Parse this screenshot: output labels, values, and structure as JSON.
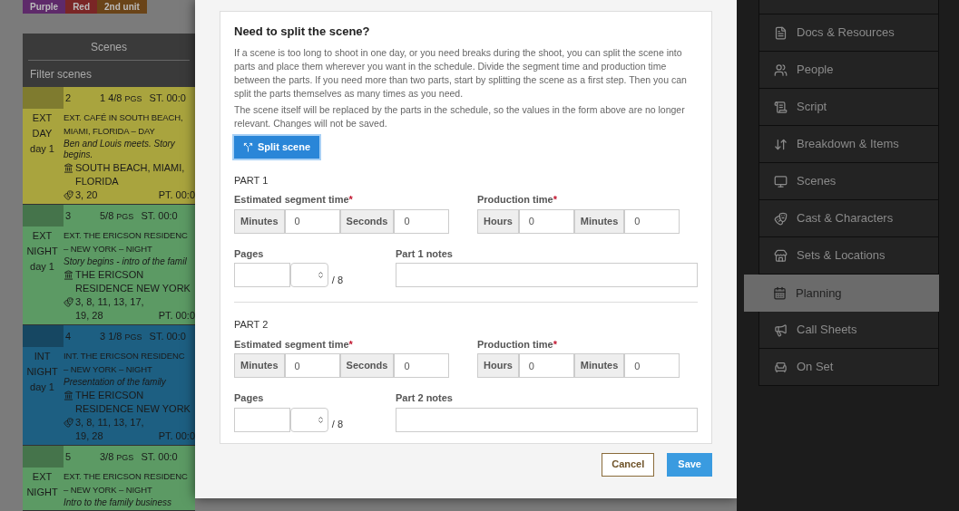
{
  "tags": [
    {
      "label": "Purple",
      "color": "#5e2a6a"
    },
    {
      "label": "Red",
      "color": "#7a2626"
    },
    {
      "label": "2nd unit",
      "color": "#6a4418"
    }
  ],
  "scenes_panel": {
    "title": "Scenes",
    "filter_placeholder": "Filter scenes",
    "scenes": [
      {
        "number": "2",
        "pages": "1 4/8",
        "pages_unit": "PGS",
        "start": "ST. 00:0",
        "int_ext": "EXT",
        "time_of_day": "DAY",
        "day": "day 1",
        "heading_lines": [
          "EXT. CAFÉ IN SOUTH BEACH,",
          "MIAMI, FLORIDA – DAY"
        ],
        "description": "Ben and Louis meets. Story begins.",
        "location": "SOUTH BEACH, MIAMI, FLORIDA",
        "cast": "3, 20",
        "pt": "PT. 00:0",
        "color": "#a9a43e"
      },
      {
        "number": "3",
        "pages": "5/8",
        "pages_unit": "PGS",
        "start": "ST. 00:0",
        "int_ext": "EXT",
        "time_of_day": "NIGHT",
        "day": "day 1",
        "heading_lines": [
          "EXT. THE ERICSON RESIDENC",
          "– NEW YORK – NIGHT"
        ],
        "description": "Story begins - intro of the famil",
        "location": "THE ERICSON RESIDENCE NEW YORK",
        "cast": "3, 8, 11, 13, 17, 19, 28",
        "pt": "PT. 00:0",
        "color": "#5c9a64"
      },
      {
        "number": "4",
        "pages": "3 1/8",
        "pages_unit": "PGS",
        "start": "ST. 00:0",
        "int_ext": "INT",
        "time_of_day": "NIGHT",
        "day": "day 1",
        "heading_lines": [
          "INT. THE ERICSON RESIDENC",
          "– NEW YORK – NIGHT"
        ],
        "description": "Presentation of the family",
        "location": "THE ERICSON RESIDENCE NEW YORK",
        "cast": "3, 8, 11, 13, 17, 19, 28",
        "pt": "PT. 00:0",
        "color": "#1d5f82"
      },
      {
        "number": "5",
        "pages": "3/8",
        "pages_unit": "PGS",
        "start": "ST. 00:0",
        "int_ext": "EXT",
        "time_of_day": "NIGHT",
        "heading_lines": [
          "EXT. THE ERICSON RESIDENC",
          "– NEW YORK – NIGHT"
        ],
        "description": "Intro to the family business",
        "color": "#5c9a64"
      }
    ]
  },
  "modal": {
    "title": "Need to split the scene?",
    "paragraphs": [
      "If a scene is too long to shoot in one day, or you need breaks during the shoot, you can split the scene into parts and place them wherever you want in the schedule. Divide the segment time and production time between the parts. If you need more than two parts, start by splitting the scene as a first step. Then you can split the parts themselves as many times as you need.",
      "The scene itself will be replaced by the parts in the schedule, so the values in the form above are no longer relevant. Changes will not be saved."
    ],
    "split_button": "Split scene",
    "parts": [
      {
        "title": "PART 1",
        "segment_label": "Estimated segment time",
        "segment_required": "*",
        "segment_fields": [
          {
            "addon": "Minutes",
            "value": "0"
          },
          {
            "addon": "Seconds",
            "value": "0"
          }
        ],
        "production_label": "Production time",
        "production_required": "*",
        "production_fields": [
          {
            "addon": "Hours",
            "value": "0"
          },
          {
            "addon": "Minutes",
            "value": "0"
          }
        ],
        "pages_label": "Pages",
        "pages_denominator": "/ 8",
        "notes_label": "Part 1 notes"
      },
      {
        "title": "PART 2",
        "segment_label": "Estimated segment time",
        "segment_required": "*",
        "segment_fields": [
          {
            "addon": "Minutes",
            "value": "0"
          },
          {
            "addon": "Seconds",
            "value": "0"
          }
        ],
        "production_label": "Production time",
        "production_required": "*",
        "production_fields": [
          {
            "addon": "Hours",
            "value": "0"
          },
          {
            "addon": "Minutes",
            "value": "0"
          }
        ],
        "pages_label": "Pages",
        "pages_denominator": "/ 8",
        "notes_label": "Part 2 notes"
      }
    ],
    "cancel": "Cancel",
    "save": "Save"
  },
  "nav": {
    "items": [
      {
        "label": "Docs & Resources",
        "selected": false
      },
      {
        "label": "People",
        "selected": false
      },
      {
        "label": "Script",
        "selected": false
      },
      {
        "label": "Breakdown & Items",
        "selected": false
      },
      {
        "label": "Scenes",
        "selected": false
      },
      {
        "label": "Cast & Characters",
        "selected": false
      },
      {
        "label": "Sets & Locations",
        "selected": false
      },
      {
        "label": "Planning",
        "selected": true
      },
      {
        "label": "Call Sheets",
        "selected": false
      },
      {
        "label": "On Set",
        "selected": false
      }
    ]
  }
}
